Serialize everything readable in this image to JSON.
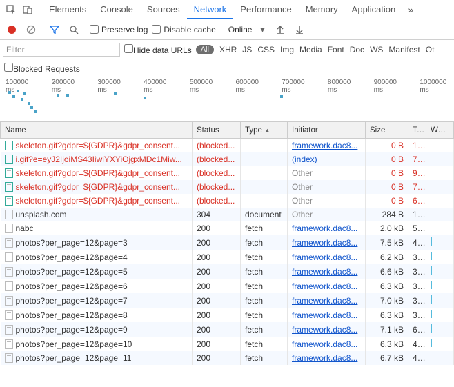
{
  "top_tabs": [
    "Elements",
    "Console",
    "Sources",
    "Network",
    "Performance",
    "Memory",
    "Application"
  ],
  "active_tab": "Network",
  "overflow_glyph": "»",
  "controls": {
    "preserve_log": "Preserve log",
    "disable_cache": "Disable cache",
    "throttling": "Online"
  },
  "filter": {
    "placeholder": "Filter",
    "hide_data_urls": "Hide data URLs",
    "types": [
      "All",
      "XHR",
      "JS",
      "CSS",
      "Img",
      "Media",
      "Font",
      "Doc",
      "WS",
      "Manifest",
      "Ot"
    ]
  },
  "blocked": {
    "label": "Blocked Requests"
  },
  "timeline_ticks": [
    "100000 ms",
    "200000 ms",
    "300000 ms",
    "400000 ms",
    "500000 ms",
    "600000 ms",
    "700000 ms",
    "800000 ms",
    "900000 ms",
    "1000000 ms"
  ],
  "headers": {
    "name": "Name",
    "status": "Status",
    "type": "Type",
    "initiator": "Initiator",
    "size": "Size",
    "time": "T...",
    "waterfall": "Water"
  },
  "rows": [
    {
      "icon": "img",
      "red": true,
      "name": "skeleton.gif?gdpr=${GDPR}&gdpr_consent...",
      "status": "(blocked...",
      "type": "",
      "initiator": "framework.dac8...",
      "ilink": true,
      "size": "0 B",
      "time": "1...",
      "wf": false
    },
    {
      "icon": "img",
      "red": true,
      "name": "i.gif?e=eyJ2IjoiMS43IiwiYXYiOjgxMDc1Miw...",
      "status": "(blocked...",
      "type": "",
      "initiator": "(index)",
      "ilink": true,
      "size": "0 B",
      "time": "7...",
      "wf": false
    },
    {
      "icon": "img",
      "red": true,
      "name": "skeleton.gif?gdpr=${GDPR}&gdpr_consent...",
      "status": "(blocked...",
      "type": "",
      "initiator": "Other",
      "ilink": false,
      "size": "0 B",
      "time": "9...",
      "wf": false
    },
    {
      "icon": "img",
      "red": true,
      "name": "skeleton.gif?gdpr=${GDPR}&gdpr_consent...",
      "status": "(blocked...",
      "type": "",
      "initiator": "Other",
      "ilink": false,
      "size": "0 B",
      "time": "7...",
      "wf": false
    },
    {
      "icon": "img",
      "red": true,
      "name": "skeleton.gif?gdpr=${GDPR}&gdpr_consent...",
      "status": "(blocked...",
      "type": "",
      "initiator": "Other",
      "ilink": false,
      "size": "0 B",
      "time": "6...",
      "wf": false
    },
    {
      "icon": "doc",
      "red": false,
      "name": "unsplash.com",
      "status": "304",
      "type": "document",
      "initiator": "Other",
      "ilink": false,
      "size": "284 B",
      "time": "1...",
      "wf": false
    },
    {
      "icon": "doc",
      "red": false,
      "name": "nabc",
      "status": "200",
      "type": "fetch",
      "initiator": "framework.dac8...",
      "ilink": true,
      "size": "2.0 kB",
      "time": "5...",
      "wf": false
    },
    {
      "icon": "doc",
      "red": false,
      "name": "photos?per_page=12&page=3",
      "status": "200",
      "type": "fetch",
      "initiator": "framework.dac8...",
      "ilink": true,
      "size": "7.5 kB",
      "time": "4...",
      "wf": true
    },
    {
      "icon": "doc",
      "red": false,
      "name": "photos?per_page=12&page=4",
      "status": "200",
      "type": "fetch",
      "initiator": "framework.dac8...",
      "ilink": true,
      "size": "6.2 kB",
      "time": "3...",
      "wf": true
    },
    {
      "icon": "doc",
      "red": false,
      "name": "photos?per_page=12&page=5",
      "status": "200",
      "type": "fetch",
      "initiator": "framework.dac8...",
      "ilink": true,
      "size": "6.6 kB",
      "time": "3...",
      "wf": true
    },
    {
      "icon": "doc",
      "red": false,
      "name": "photos?per_page=12&page=6",
      "status": "200",
      "type": "fetch",
      "initiator": "framework.dac8...",
      "ilink": true,
      "size": "6.3 kB",
      "time": "3...",
      "wf": true
    },
    {
      "icon": "doc",
      "red": false,
      "name": "photos?per_page=12&page=7",
      "status": "200",
      "type": "fetch",
      "initiator": "framework.dac8...",
      "ilink": true,
      "size": "7.0 kB",
      "time": "3...",
      "wf": true
    },
    {
      "icon": "doc",
      "red": false,
      "name": "photos?per_page=12&page=8",
      "status": "200",
      "type": "fetch",
      "initiator": "framework.dac8...",
      "ilink": true,
      "size": "6.3 kB",
      "time": "3...",
      "wf": true
    },
    {
      "icon": "doc",
      "red": false,
      "name": "photos?per_page=12&page=9",
      "status": "200",
      "type": "fetch",
      "initiator": "framework.dac8...",
      "ilink": true,
      "size": "7.1 kB",
      "time": "6...",
      "wf": true
    },
    {
      "icon": "doc",
      "red": false,
      "name": "photos?per_page=12&page=10",
      "status": "200",
      "type": "fetch",
      "initiator": "framework.dac8...",
      "ilink": true,
      "size": "6.3 kB",
      "time": "4...",
      "wf": true
    },
    {
      "icon": "doc",
      "red": false,
      "name": "photos?per_page=12&page=11",
      "status": "200",
      "type": "fetch",
      "initiator": "framework.dac8...",
      "ilink": true,
      "size": "6.7 kB",
      "time": "4...",
      "wf": false
    }
  ]
}
